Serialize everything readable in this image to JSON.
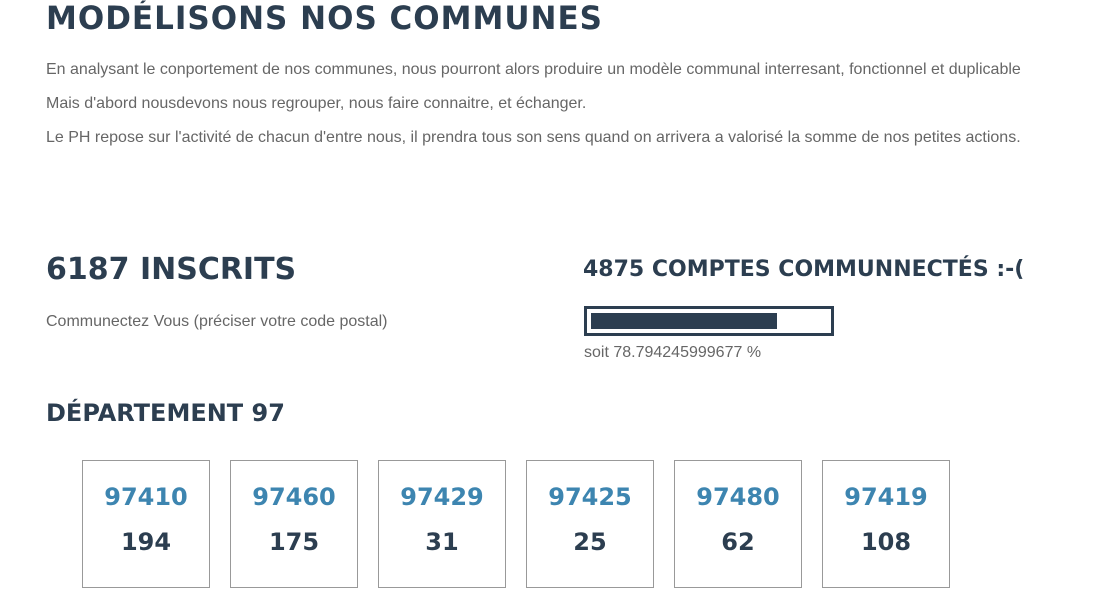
{
  "header": {
    "title": "MODÉLISONS NOS COMMUNES"
  },
  "intro": {
    "paragraph1": "En analysant le conportement de nos communes, nous pourront alors produire un modèle communal interresant, fonctionnel et duplicable",
    "paragraph2": "Mais d'abord nousdevons nous regrouper, nous faire connaitre, et échanger.",
    "paragraph3": "Le PH repose sur l'activité de chacun d'entre nous, il prendra tous son sens quand on arrivera a valorisé la somme de nos petites actions."
  },
  "stats": {
    "registered_title": "6187 INSCRITS",
    "registered_hint": "Communectez Vous (préciser votre code postal)",
    "connected_title": "4875 COMPTES COMMUNNECTÉS :-(",
    "progress_fraction": 0.788,
    "percent_text": "soit 78.794245999677 %"
  },
  "department": {
    "title": "DÉPARTEMENT 97",
    "cards": [
      {
        "code": "97410",
        "count": "194"
      },
      {
        "code": "97460",
        "count": "175"
      },
      {
        "code": "97429",
        "count": "31"
      },
      {
        "code": "97425",
        "count": "25"
      },
      {
        "code": "97480",
        "count": "62"
      },
      {
        "code": "97419",
        "count": "108"
      }
    ]
  },
  "colors": {
    "dark": "#2c3e50",
    "link": "#3d85b0",
    "text": "#666666"
  }
}
